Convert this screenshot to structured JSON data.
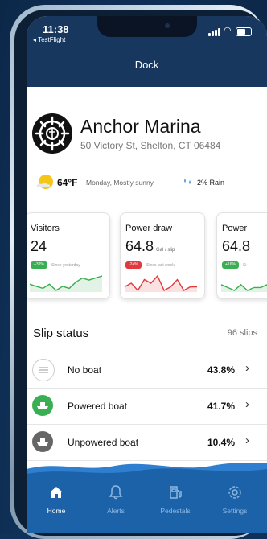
{
  "status_bar": {
    "time": "11:38",
    "back_app": "◂ TestFlight"
  },
  "header": {
    "title": "Dock"
  },
  "marina": {
    "name": "Anchor Marina",
    "address": "50 Victory St, Shelton, CT 06484"
  },
  "weather": {
    "temp": "64°F",
    "description": "Monday, Mostly sunny",
    "rain": "2% Rain",
    "icon": "partly-sunny-icon"
  },
  "cards": [
    {
      "title": "Visitors",
      "value": "24",
      "unit": "",
      "badge": "+32%",
      "badge_color": "#3aae52",
      "note": "Since yesterday",
      "trend": [
        6,
        5,
        4,
        6,
        3,
        5,
        4,
        7,
        9,
        8,
        9,
        10
      ]
    },
    {
      "title": "Power draw",
      "value": "64.8",
      "unit": "Gal / slip",
      "badge": "-24%",
      "badge_color": "#e0393e",
      "note": "Since last week",
      "trend": [
        5,
        6,
        4,
        7,
        6,
        8,
        4,
        5,
        7,
        4,
        5,
        5
      ]
    },
    {
      "title": "Power",
      "value": "64.8",
      "unit": "",
      "badge": "+16%",
      "badge_color": "#3aae52",
      "note": "Si",
      "trend": [
        6,
        5,
        4,
        6,
        4,
        5,
        5,
        6,
        7,
        8,
        9,
        9
      ]
    }
  ],
  "slip_status": {
    "title": "Slip status",
    "count": "96 slips",
    "rows": [
      {
        "label": "No boat",
        "pct": "43.8%",
        "icon": "no-boat-icon",
        "color": "#9a9a9a"
      },
      {
        "label": "Powered boat",
        "pct": "41.7%",
        "icon": "powered-boat-icon",
        "color": "#3aae52"
      },
      {
        "label": "Unpowered boat",
        "pct": "10.4%",
        "icon": "unpowered-boat-icon",
        "color": "#666666"
      }
    ]
  },
  "tabs": [
    {
      "label": "Home",
      "icon": "home-icon",
      "active": true
    },
    {
      "label": "Alerts",
      "icon": "bell-icon",
      "active": false
    },
    {
      "label": "Pedestals",
      "icon": "fuel-pump-icon",
      "active": false
    },
    {
      "label": "Settings",
      "icon": "gear-icon",
      "active": false
    }
  ],
  "colors": {
    "nav": "#17375e",
    "tab_bar": "#1b62a9",
    "tab_active": "#ffffff",
    "tab_inactive": "#8fb7e0"
  }
}
